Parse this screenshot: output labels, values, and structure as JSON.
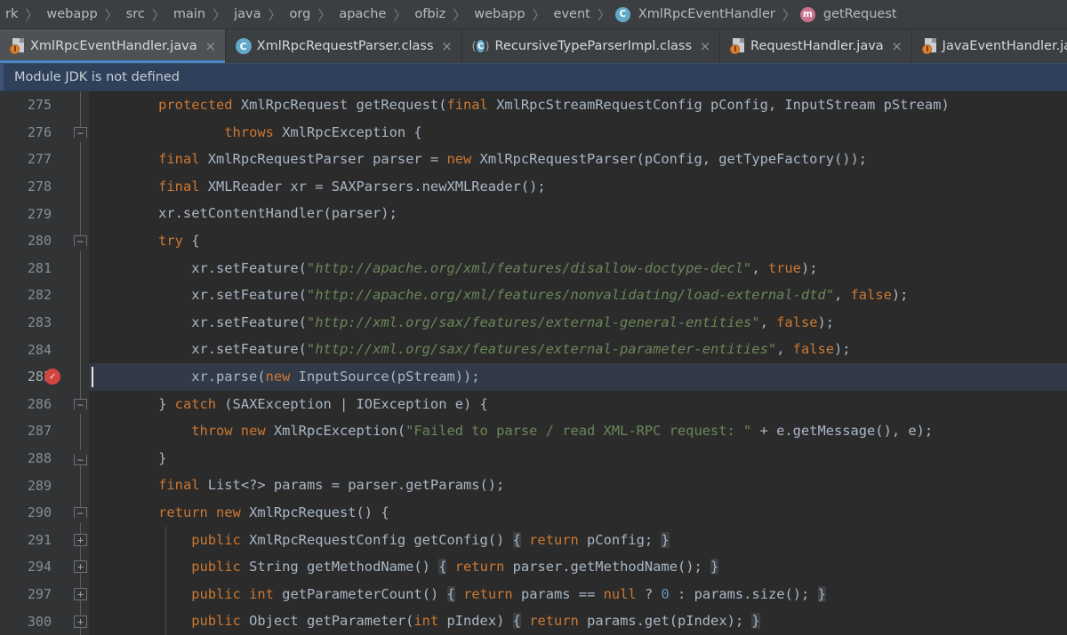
{
  "breadcrumb": {
    "items": [
      {
        "label": "rk",
        "icon": null
      },
      {
        "label": "webapp",
        "icon": null
      },
      {
        "label": "src",
        "icon": null
      },
      {
        "label": "main",
        "icon": null
      },
      {
        "label": "java",
        "icon": null
      },
      {
        "label": "org",
        "icon": null
      },
      {
        "label": "apache",
        "icon": null
      },
      {
        "label": "ofbiz",
        "icon": null
      },
      {
        "label": "webapp",
        "icon": null
      },
      {
        "label": "event",
        "icon": null
      },
      {
        "label": "XmlRpcEventHandler",
        "icon": "class-icon",
        "icon_glyph": "C"
      },
      {
        "label": "getRequest",
        "icon": "method-icon",
        "icon_glyph": "m"
      }
    ],
    "separator": "〉"
  },
  "tabs": [
    {
      "label": "XmlRpcEventHandler.java",
      "icon": "java-file-icon",
      "active": true,
      "close": "×"
    },
    {
      "label": "XmlRpcRequestParser.class",
      "icon": "class-file-icon",
      "active": false,
      "close": "×"
    },
    {
      "label": "RecursiveTypeParserImpl.class",
      "icon": "library-class-icon",
      "active": false,
      "close": "×"
    },
    {
      "label": "RequestHandler.java",
      "icon": "java-file-icon",
      "active": false,
      "close": "×"
    },
    {
      "label": "JavaEventHandler.java",
      "icon": "java-file-icon",
      "active": false,
      "close": "×"
    }
  ],
  "notification": {
    "message": "Module JDK is not defined"
  },
  "editor": {
    "current_line": 285,
    "breakpoint_line": 285,
    "lines": [
      {
        "no": "275",
        "fold": "none",
        "html": "        <span class=\"kw\">protected</span> XmlRpcRequest getRequest(<span class=\"kw\">final</span> XmlRpcStreamRequestConfig pConfig, InputStream pStream)"
      },
      {
        "no": "276",
        "fold": "shield-down",
        "html": "                <span class=\"kw\">throws</span> XmlRpcException {"
      },
      {
        "no": "277",
        "fold": "none",
        "html": "        <span class=\"kw\">final</span> XmlRpcRequestParser parser = <span class=\"kw\">new</span> XmlRpcRequestParser(pConfig, getTypeFactory());"
      },
      {
        "no": "278",
        "fold": "none",
        "html": "        <span class=\"kw\">final</span> XMLReader xr = SAXParsers.newXMLReader();"
      },
      {
        "no": "279",
        "fold": "none",
        "html": "        xr.setContentHandler(parser);"
      },
      {
        "no": "280",
        "fold": "shield-down",
        "html": "        <span class=\"kw\">try</span> {"
      },
      {
        "no": "281",
        "fold": "none",
        "html": "            xr.setFeature(<span class=\"str\">\"</span><span class=\"url\">http://apache.org/xml/features/disallow-doctype-decl</span><span class=\"str\">\"</span>, <span class=\"kw\">true</span>);"
      },
      {
        "no": "282",
        "fold": "none",
        "html": "            xr.setFeature(<span class=\"str\">\"</span><span class=\"url\">http://apache.org/xml/features/nonvalidating/load-external-dtd</span><span class=\"str\">\"</span>, <span class=\"kw\">false</span>);"
      },
      {
        "no": "283",
        "fold": "none",
        "html": "            xr.setFeature(<span class=\"str\">\"</span><span class=\"url\">http://xml.org/sax/features/external-general-entities</span><span class=\"str\">\"</span>, <span class=\"kw\">false</span>);"
      },
      {
        "no": "284",
        "fold": "none",
        "html": "            xr.setFeature(<span class=\"str\">\"</span><span class=\"url\">http://xml.org/sax/features/external-parameter-entities</span><span class=\"str\">\"</span>, <span class=\"kw\">false</span>);"
      },
      {
        "no": "285",
        "fold": "none",
        "html": "            xr.parse(<span class=\"kw\">new</span> InputSource(pStream));"
      },
      {
        "no": "286",
        "fold": "shield-down",
        "html": "        } <span class=\"kw\">catch</span> (SAXException | IOException e) {"
      },
      {
        "no": "287",
        "fold": "none",
        "html": "            <span class=\"kw\">throw new</span> XmlRpcException(<span class=\"str\">\"Failed to parse / read XML-RPC request: \"</span> + e.getMessage(), e);"
      },
      {
        "no": "288",
        "fold": "shield-up",
        "html": "        }"
      },
      {
        "no": "289",
        "fold": "none",
        "html": "        <span class=\"kw\">final</span> List&lt;?&gt; params = parser.getParams();"
      },
      {
        "no": "290",
        "fold": "shield-down",
        "html": "        <span class=\"kw\">return new</span> XmlRpcRequest() {"
      },
      {
        "no": "291",
        "fold": "boxed-plus",
        "html": "            <span class=\"kw\">public</span> XmlRpcRequestConfig getConfig() <span class=\"fold-brace\">{</span> <span class=\"kw\">return</span> pConfig; <span class=\"fold-brace\">}</span>"
      },
      {
        "no": "294",
        "fold": "boxed-plus",
        "html": "            <span class=\"kw\">public</span> String getMethodName() <span class=\"fold-brace\">{</span> <span class=\"kw\">return</span> parser.getMethodName(); <span class=\"fold-brace\">}</span>"
      },
      {
        "no": "297",
        "fold": "boxed-plus",
        "html": "            <span class=\"kw\">public</span> <span class=\"kw\">int</span> getParameterCount() <span class=\"fold-brace\">{</span> <span class=\"kw\">return</span> params == <span class=\"kw\">null</span> ? <span class=\"num\">0</span> : params.size(); <span class=\"fold-brace\">}</span>"
      },
      {
        "no": "300",
        "fold": "boxed-plus",
        "html": "            <span class=\"kw\">public</span> Object getParameter(<span class=\"kw\">int</span> pIndex) <span class=\"fold-brace\">{</span> <span class=\"kw\">return</span> params.get(pIndex); <span class=\"fold-brace\">}</span>"
      }
    ]
  },
  "colors": {
    "editor_background": "#2b2b2b",
    "gutter_background": "#313335",
    "chrome_background": "#3c3f41",
    "active_tab_background": "#4e5254",
    "active_tab_underline": "#4a88c7",
    "notification_background": "#2f415a",
    "current_line_highlight": "#323a47",
    "keyword": "#cc7832",
    "string": "#6a8759",
    "number": "#6897bb",
    "default_text": "#a9b7c6",
    "breakpoint": "#d1453f",
    "class_icon": "#62a8c7",
    "method_icon": "#c9738f"
  }
}
